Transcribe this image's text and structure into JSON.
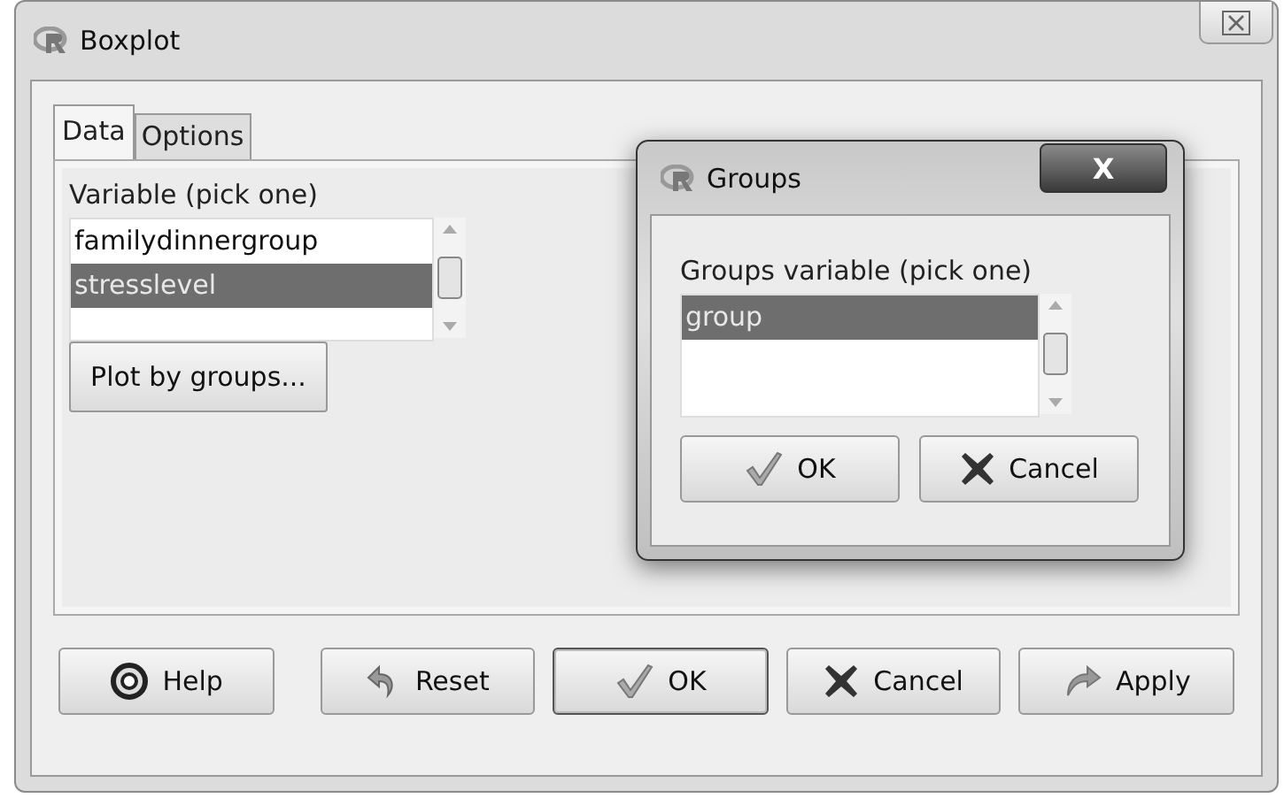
{
  "window": {
    "title": "Boxplot"
  },
  "tabs": [
    {
      "label": "Data",
      "selected": true
    },
    {
      "label": "Options",
      "selected": false
    }
  ],
  "variable_list": {
    "label": "Variable (pick one)",
    "items": [
      {
        "label": "familydinnergroup",
        "selected": false
      },
      {
        "label": "stresslevel",
        "selected": true
      }
    ]
  },
  "plot_by_groups": {
    "label": "Plot by groups..."
  },
  "buttons": [
    {
      "kind": "help",
      "label": "Help",
      "default": false
    },
    {
      "kind": "reset",
      "label": "Reset",
      "default": false
    },
    {
      "kind": "ok",
      "label": "OK",
      "default": true
    },
    {
      "kind": "cancel",
      "label": "Cancel",
      "default": false
    },
    {
      "kind": "apply",
      "label": "Apply",
      "default": false
    }
  ],
  "groups_dialog": {
    "title": "Groups",
    "close": "X",
    "label": "Groups variable (pick one)",
    "items": [
      {
        "label": "group",
        "selected": true
      }
    ],
    "buttons": [
      {
        "kind": "ok",
        "label": "OK",
        "default": false
      },
      {
        "kind": "cancel",
        "label": "Cancel",
        "default": false
      }
    ]
  }
}
